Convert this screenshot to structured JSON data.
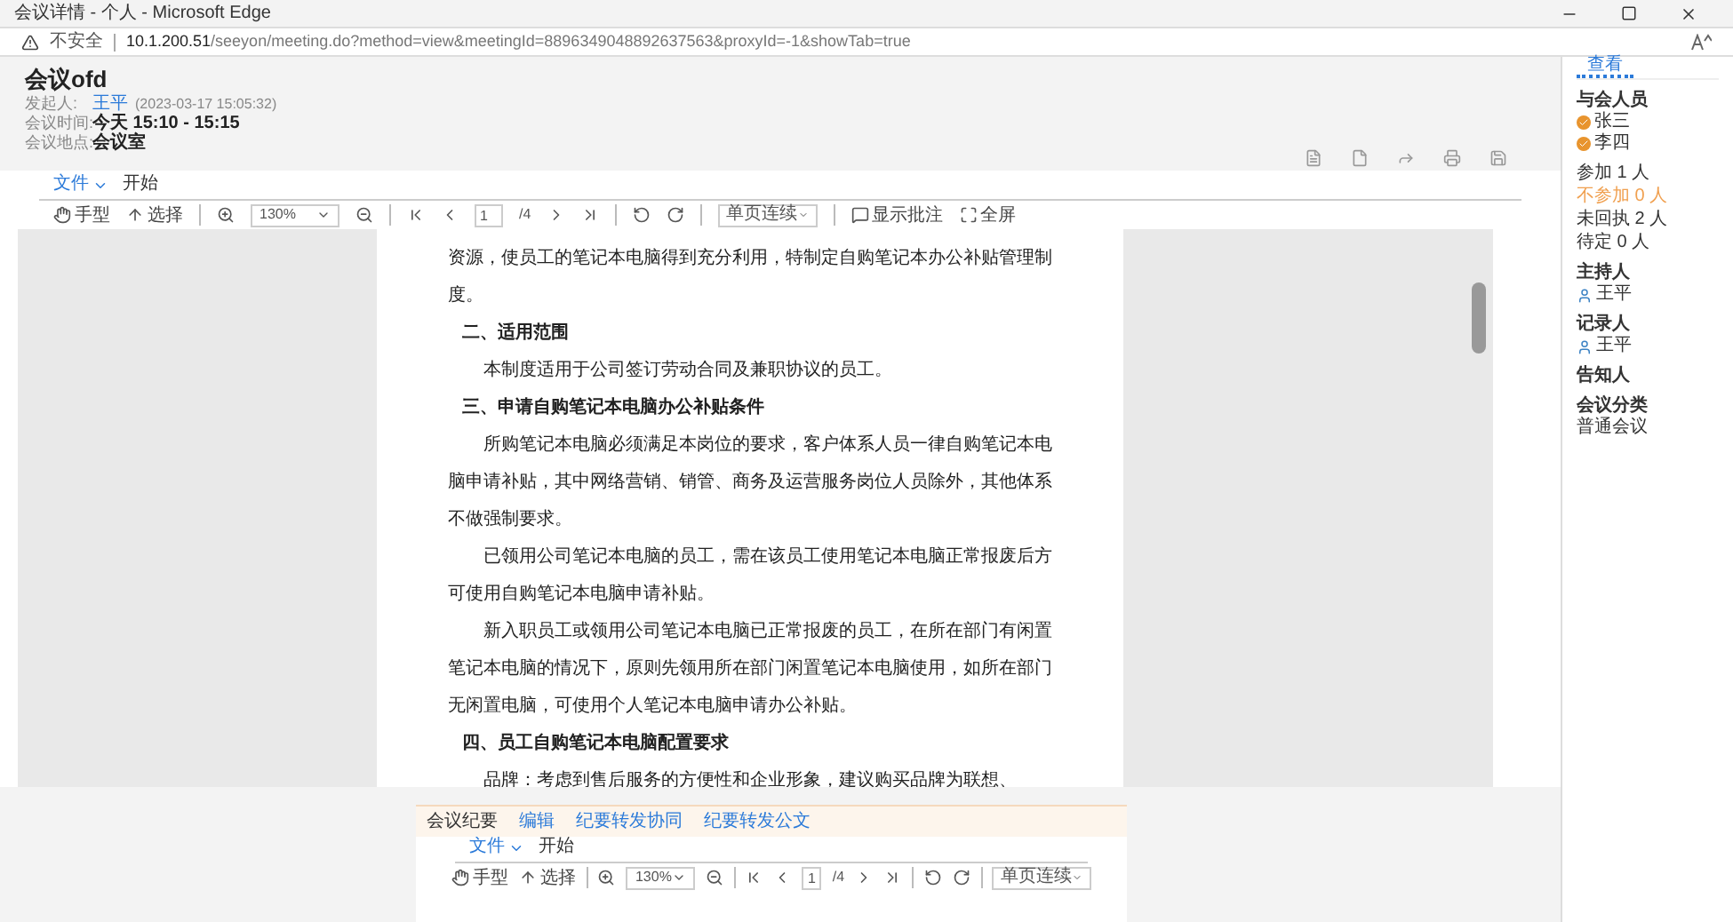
{
  "window": {
    "title": "会议详情 - 个人 - Microsoft Edge"
  },
  "address_bar": {
    "security": "不安全",
    "url_host": "10.1.200.51",
    "url_path": "/seeyon/meeting.do?method=view&meetingId=8896349048892637563&proxyId=-1&showTab=true"
  },
  "meeting": {
    "title": "会议ofd",
    "fields": [
      {
        "label": "发起人:",
        "value": "王平",
        "note": "(2023-03-17 15:05:32)",
        "kind": "link"
      },
      {
        "label": "会议时间:",
        "value": "今天 15:10 - 15:15",
        "kind": "bold"
      },
      {
        "label": "会议地点:",
        "value": "会议室",
        "kind": "bold"
      }
    ]
  },
  "viewer": {
    "menu": [
      {
        "label": "文件",
        "selected": true
      },
      {
        "label": "开始",
        "selected": false
      }
    ],
    "hand": "手型",
    "select": "选择",
    "zoom": "130%",
    "page": "1",
    "page_total": "/4",
    "view_mode": "单页连续",
    "annotations": "显示批注",
    "fullscreen": "全屏"
  },
  "document": [
    {
      "kind": "text",
      "text": "资源，使员工的笔记本电脑得到充分利用，特制定自购笔记本办公补贴管理制度。"
    },
    {
      "kind": "heading",
      "text": "二、适用范围"
    },
    {
      "kind": "para",
      "text": "本制度适用于公司签订劳动合同及兼职协议的员工。"
    },
    {
      "kind": "heading",
      "text": "三、申请自购笔记本电脑办公补贴条件"
    },
    {
      "kind": "para",
      "text": "所购笔记本电脑必须满足本岗位的要求，客户体系人员一律自购笔记本电脑申请补贴，其中网络营销、销管、商务及运营服务岗位人员除外，其他体系不做强制要求。"
    },
    {
      "kind": "para",
      "text": "已领用公司笔记本电脑的员工，需在该员工使用笔记本电脑正常报废后方可使用自购笔记本电脑申请补贴。"
    },
    {
      "kind": "para",
      "text": "新入职员工或领用公司笔记本电脑已正常报废的员工，在所在部门有闲置笔记本电脑的情况下，原则先领用所在部门闲置笔记本电脑使用，如所在部门无闲置电脑，可使用个人笔记本电脑申请办公补贴。"
    },
    {
      "kind": "heading",
      "text": "四、员工自购笔记本电脑配置要求"
    },
    {
      "kind": "para",
      "text": "品牌：考虑到售后服务的方便性和企业形象，建议购买品牌为联想、"
    }
  ],
  "minutes": {
    "title": "会议纪要",
    "links": [
      "编辑",
      "纪要转发协同",
      "纪要转发公文"
    ],
    "viewer": {
      "menu": [
        {
          "label": "文件",
          "selected": true
        },
        {
          "label": "开始",
          "selected": false
        }
      ],
      "hand": "手型",
      "select": "选择",
      "zoom": "130%",
      "page": "1",
      "page_total": "/4",
      "view_mode": "单页连续"
    }
  },
  "sidebar": {
    "tabs": [
      {
        "label": "查看",
        "selected": true
      }
    ],
    "attendees": {
      "title": "与会人员",
      "people": [
        "张三",
        "李四"
      ]
    },
    "stats": [
      {
        "text": "参加 1 人",
        "color": "#333333"
      },
      {
        "text": "不参加 0 人",
        "color": "#f0a050"
      },
      {
        "text": "未回执 2 人",
        "color": "#333333"
      },
      {
        "text": "待定 0 人",
        "color": "#333333"
      }
    ],
    "roles": [
      {
        "title": "主持人",
        "people": [
          "王平"
        ]
      },
      {
        "title": "记录人",
        "people": [
          "王平"
        ]
      },
      {
        "title": "告知人"
      }
    ],
    "category": {
      "title": "会议分类",
      "value": "普通会议"
    }
  }
}
